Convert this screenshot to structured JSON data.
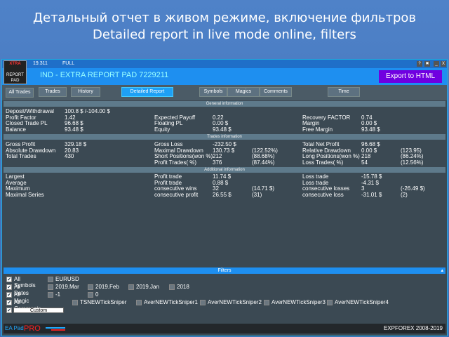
{
  "banner": {
    "line1": "Детальный отчет в живом режиме, включение фильтров",
    "line2": "Detailed report in live mode online, filters"
  },
  "titlebar": {
    "version": "19.311",
    "mode": "FULL"
  },
  "logo": {
    "text": "XTRA REPORT PAD"
  },
  "header": {
    "title": "IND - EXTRA REPORT PAD 7229211",
    "export": "Export to HTML"
  },
  "window_buttons": [
    "?",
    "✖",
    "_",
    "X"
  ],
  "tabs": [
    "All Trades",
    "Trades",
    "History",
    "Detailed Report",
    "Symbols",
    "Magics",
    "Comments",
    "Time"
  ],
  "sections": {
    "general": "General information",
    "trades": "Trades information",
    "additional": "Additional information"
  },
  "general": [
    [
      "Deposit/Withdrawal",
      "100.8 $  /-104.00 $",
      "",
      "",
      "",
      "",
      "",
      ""
    ],
    [
      "Profit Factor",
      "1.42",
      "Expected Payoff",
      "0.22",
      "",
      "Recovery FACTOR",
      "0.74",
      ""
    ],
    [
      "Closed Trade PL",
      "96.68 $",
      "Floating PL",
      "0.00 $",
      "",
      "Margin",
      "0.00 $",
      ""
    ],
    [
      "Balance",
      "93.48 $",
      "Equity",
      "93.48 $",
      "",
      "Free Margin",
      "93.48 $",
      ""
    ]
  ],
  "trades": [
    [
      "Gross Profit",
      "329.18 $",
      "Gross Loss",
      "-232.50 $",
      "",
      "Total Net Profit",
      "96.68 $",
      ""
    ],
    [
      "Absolute Drawdown",
      "20.83",
      "Maximal Drawdown",
      "130.73 $",
      "(122.52%)",
      "Relative Drawdown",
      "0.00 $",
      "(123.95)"
    ],
    [
      "Total Trades",
      "430",
      "Short Positions(won %)",
      "212",
      "(88.68%)",
      "Long Positions(won %)",
      "218",
      "(86.24%)"
    ],
    [
      "",
      "",
      "Profit Trades( %)",
      "376",
      "(87.44%)",
      "Loss Trades( %)",
      "54",
      "(12.56%)"
    ]
  ],
  "additional": [
    [
      "Largest",
      "",
      "Profit trade",
      "11.74 $",
      "",
      "Loss trade",
      "-15.78 $",
      ""
    ],
    [
      "Average",
      "",
      "Profit trade",
      "0.88 $",
      "",
      "Loss trade",
      "-4.31 $",
      ""
    ],
    [
      "Maximum",
      "",
      "consecutive wins",
      "32",
      "(14.71 $)",
      "consecutive losses",
      "3",
      "(-26.49 $)"
    ],
    [
      "Maximal Series",
      "",
      "consecutive profit",
      "26.55 $",
      "(31)",
      "consecutive loss",
      "-31.01 $",
      "(2)"
    ]
  ],
  "filters": {
    "title": "Filters",
    "rows": [
      {
        "all": "All Symbols",
        "items": [
          "EURUSD"
        ]
      },
      {
        "all": "All Dates",
        "items": [
          "2019.Mar",
          "2019.Feb",
          "2019.Jan",
          "2018"
        ]
      },
      {
        "all": "All Magic",
        "items": [
          "-1",
          "0"
        ]
      },
      {
        "all": "All Comments",
        "items": [
          "TSNEWTickSniper",
          "AverNEWTickSniper1",
          "AverNEWTickSniper2",
          "AverNEWTickSniper3",
          "AverNEWTickSniper4"
        ]
      }
    ],
    "custom": "Custom"
  },
  "footer": {
    "brand1": "EA Pad",
    "brand2": "PRO",
    "copyright": "EXPFOREX 2008-2019"
  }
}
